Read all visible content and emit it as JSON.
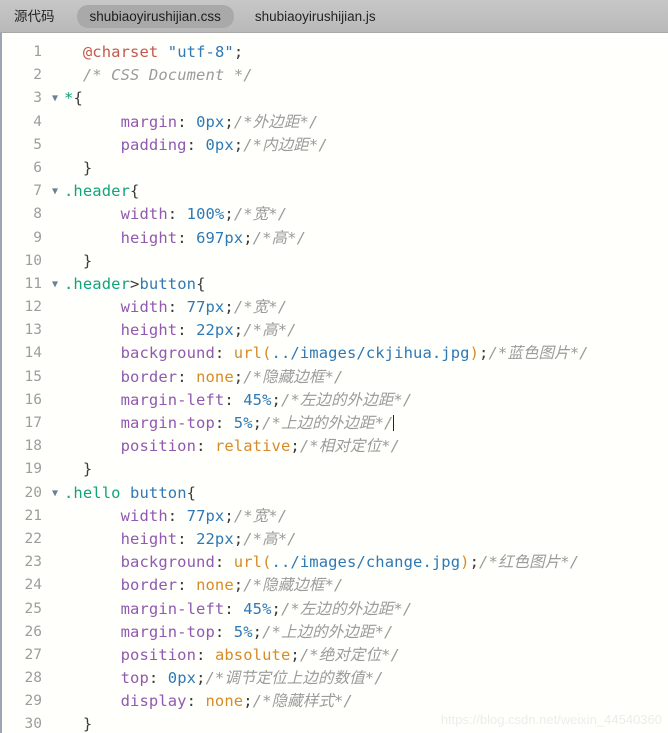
{
  "tabbar": {
    "source_label": "源代码",
    "tabs": [
      {
        "label": "shubiaoyirushijian.css",
        "active": true
      },
      {
        "label": "shubiaoyirushijian.js",
        "active": false
      }
    ]
  },
  "editor": {
    "language": "css",
    "caret_line": 17,
    "fold_marker_glyph": "▼",
    "colors": {
      "background": "#fffffb",
      "tabbar_background": "#c0c0c0",
      "active_tab_background": "#a9a9a9",
      "gutter_number": "#9d9d9d",
      "left_border": "#9aa6b4",
      "at_rule": "#c2594f",
      "string": "#2f79b5",
      "comment": "#9b9b9b",
      "selector_class": "#12a37c",
      "selector_tag": "#2f79b5",
      "property": "#9159b0",
      "value": "#2f79b5",
      "keyword": "#d78b29",
      "punctuation": "#3b3b3b"
    },
    "lines": [
      {
        "n": 1,
        "fold": false,
        "tokens": [
          {
            "t": "plain",
            "v": "  "
          },
          {
            "t": "at",
            "v": "@charset"
          },
          {
            "t": "plain",
            "v": " "
          },
          {
            "t": "str",
            "v": "\"utf-8\""
          },
          {
            "t": "punc",
            "v": ";"
          }
        ]
      },
      {
        "n": 2,
        "fold": false,
        "tokens": [
          {
            "t": "plain",
            "v": "  "
          },
          {
            "t": "com",
            "v": "/* CSS Document */"
          }
        ]
      },
      {
        "n": 3,
        "fold": true,
        "tokens": [
          {
            "t": "sel",
            "v": "*"
          },
          {
            "t": "punc",
            "v": "{"
          }
        ]
      },
      {
        "n": 4,
        "fold": false,
        "tokens": [
          {
            "t": "plain",
            "v": "      "
          },
          {
            "t": "prop",
            "v": "margin"
          },
          {
            "t": "punc",
            "v": ":"
          },
          {
            "t": "plain",
            "v": " "
          },
          {
            "t": "val",
            "v": "0px"
          },
          {
            "t": "punc",
            "v": ";"
          },
          {
            "t": "com",
            "v": "/*外边距*/"
          }
        ]
      },
      {
        "n": 5,
        "fold": false,
        "tokens": [
          {
            "t": "plain",
            "v": "      "
          },
          {
            "t": "prop",
            "v": "padding"
          },
          {
            "t": "punc",
            "v": ":"
          },
          {
            "t": "plain",
            "v": " "
          },
          {
            "t": "val",
            "v": "0px"
          },
          {
            "t": "punc",
            "v": ";"
          },
          {
            "t": "com",
            "v": "/*内边距*/"
          }
        ]
      },
      {
        "n": 6,
        "fold": false,
        "tokens": [
          {
            "t": "punc",
            "v": "  }"
          }
        ]
      },
      {
        "n": 7,
        "fold": true,
        "tokens": [
          {
            "t": "sel",
            "v": ".header"
          },
          {
            "t": "punc",
            "v": "{"
          }
        ]
      },
      {
        "n": 8,
        "fold": false,
        "tokens": [
          {
            "t": "plain",
            "v": "      "
          },
          {
            "t": "prop",
            "v": "width"
          },
          {
            "t": "punc",
            "v": ":"
          },
          {
            "t": "plain",
            "v": " "
          },
          {
            "t": "val",
            "v": "100%"
          },
          {
            "t": "punc",
            "v": ";"
          },
          {
            "t": "com",
            "v": "/*宽*/"
          }
        ]
      },
      {
        "n": 9,
        "fold": false,
        "tokens": [
          {
            "t": "plain",
            "v": "      "
          },
          {
            "t": "prop",
            "v": "height"
          },
          {
            "t": "punc",
            "v": ":"
          },
          {
            "t": "plain",
            "v": " "
          },
          {
            "t": "val",
            "v": "697px"
          },
          {
            "t": "punc",
            "v": ";"
          },
          {
            "t": "com",
            "v": "/*高*/"
          }
        ]
      },
      {
        "n": 10,
        "fold": false,
        "tokens": [
          {
            "t": "punc",
            "v": "  }"
          }
        ]
      },
      {
        "n": 11,
        "fold": true,
        "tokens": [
          {
            "t": "sel",
            "v": ".header"
          },
          {
            "t": "punc",
            "v": ">"
          },
          {
            "t": "tag",
            "v": "button"
          },
          {
            "t": "punc",
            "v": "{"
          }
        ]
      },
      {
        "n": 12,
        "fold": false,
        "tokens": [
          {
            "t": "plain",
            "v": "      "
          },
          {
            "t": "prop",
            "v": "width"
          },
          {
            "t": "punc",
            "v": ":"
          },
          {
            "t": "plain",
            "v": " "
          },
          {
            "t": "val",
            "v": "77px"
          },
          {
            "t": "punc",
            "v": ";"
          },
          {
            "t": "com",
            "v": "/*宽*/"
          }
        ]
      },
      {
        "n": 13,
        "fold": false,
        "tokens": [
          {
            "t": "plain",
            "v": "      "
          },
          {
            "t": "prop",
            "v": "height"
          },
          {
            "t": "punc",
            "v": ":"
          },
          {
            "t": "plain",
            "v": " "
          },
          {
            "t": "val",
            "v": "22px"
          },
          {
            "t": "punc",
            "v": ";"
          },
          {
            "t": "com",
            "v": "/*高*/"
          }
        ]
      },
      {
        "n": 14,
        "fold": false,
        "tokens": [
          {
            "t": "plain",
            "v": "      "
          },
          {
            "t": "prop",
            "v": "background"
          },
          {
            "t": "punc",
            "v": ":"
          },
          {
            "t": "plain",
            "v": " "
          },
          {
            "t": "func",
            "v": "url("
          },
          {
            "t": "val",
            "v": "../images/ckjihua.jpg"
          },
          {
            "t": "func",
            "v": ")"
          },
          {
            "t": "punc",
            "v": ";"
          },
          {
            "t": "com",
            "v": "/*蓝色图片*/"
          }
        ]
      },
      {
        "n": 15,
        "fold": false,
        "tokens": [
          {
            "t": "plain",
            "v": "      "
          },
          {
            "t": "prop",
            "v": "border"
          },
          {
            "t": "punc",
            "v": ":"
          },
          {
            "t": "plain",
            "v": " "
          },
          {
            "t": "kw",
            "v": "none"
          },
          {
            "t": "punc",
            "v": ";"
          },
          {
            "t": "com",
            "v": "/*隐藏边框*/"
          }
        ]
      },
      {
        "n": 16,
        "fold": false,
        "tokens": [
          {
            "t": "plain",
            "v": "      "
          },
          {
            "t": "prop",
            "v": "margin-left"
          },
          {
            "t": "punc",
            "v": ":"
          },
          {
            "t": "plain",
            "v": " "
          },
          {
            "t": "val",
            "v": "45%"
          },
          {
            "t": "punc",
            "v": ";"
          },
          {
            "t": "com",
            "v": "/*左边的外边距*/"
          }
        ]
      },
      {
        "n": 17,
        "fold": false,
        "caret": true,
        "tokens": [
          {
            "t": "plain",
            "v": "      "
          },
          {
            "t": "prop",
            "v": "margin-top"
          },
          {
            "t": "punc",
            "v": ":"
          },
          {
            "t": "plain",
            "v": " "
          },
          {
            "t": "val",
            "v": "5%"
          },
          {
            "t": "punc",
            "v": ";"
          },
          {
            "t": "com",
            "v": "/*上边的外边距*/"
          }
        ]
      },
      {
        "n": 18,
        "fold": false,
        "tokens": [
          {
            "t": "plain",
            "v": "      "
          },
          {
            "t": "prop",
            "v": "position"
          },
          {
            "t": "punc",
            "v": ":"
          },
          {
            "t": "plain",
            "v": " "
          },
          {
            "t": "kw",
            "v": "relative"
          },
          {
            "t": "punc",
            "v": ";"
          },
          {
            "t": "com",
            "v": "/*相对定位*/"
          }
        ]
      },
      {
        "n": 19,
        "fold": false,
        "tokens": [
          {
            "t": "punc",
            "v": "  }"
          }
        ]
      },
      {
        "n": 20,
        "fold": true,
        "tokens": [
          {
            "t": "sel",
            "v": ".hello"
          },
          {
            "t": "plain",
            "v": " "
          },
          {
            "t": "tag",
            "v": "button"
          },
          {
            "t": "punc",
            "v": "{"
          }
        ]
      },
      {
        "n": 21,
        "fold": false,
        "tokens": [
          {
            "t": "plain",
            "v": "      "
          },
          {
            "t": "prop",
            "v": "width"
          },
          {
            "t": "punc",
            "v": ":"
          },
          {
            "t": "plain",
            "v": " "
          },
          {
            "t": "val",
            "v": "77px"
          },
          {
            "t": "punc",
            "v": ";"
          },
          {
            "t": "com",
            "v": "/*宽*/"
          }
        ]
      },
      {
        "n": 22,
        "fold": false,
        "tokens": [
          {
            "t": "plain",
            "v": "      "
          },
          {
            "t": "prop",
            "v": "height"
          },
          {
            "t": "punc",
            "v": ":"
          },
          {
            "t": "plain",
            "v": " "
          },
          {
            "t": "val",
            "v": "22px"
          },
          {
            "t": "punc",
            "v": ";"
          },
          {
            "t": "com",
            "v": "/*高*/"
          }
        ]
      },
      {
        "n": 23,
        "fold": false,
        "tokens": [
          {
            "t": "plain",
            "v": "      "
          },
          {
            "t": "prop",
            "v": "background"
          },
          {
            "t": "punc",
            "v": ":"
          },
          {
            "t": "plain",
            "v": " "
          },
          {
            "t": "func",
            "v": "url("
          },
          {
            "t": "val",
            "v": "../images/change.jpg"
          },
          {
            "t": "func",
            "v": ")"
          },
          {
            "t": "punc",
            "v": ";"
          },
          {
            "t": "com",
            "v": "/*红色图片*/"
          }
        ]
      },
      {
        "n": 24,
        "fold": false,
        "tokens": [
          {
            "t": "plain",
            "v": "      "
          },
          {
            "t": "prop",
            "v": "border"
          },
          {
            "t": "punc",
            "v": ":"
          },
          {
            "t": "plain",
            "v": " "
          },
          {
            "t": "kw",
            "v": "none"
          },
          {
            "t": "punc",
            "v": ";"
          },
          {
            "t": "com",
            "v": "/*隐藏边框*/"
          }
        ]
      },
      {
        "n": 25,
        "fold": false,
        "tokens": [
          {
            "t": "plain",
            "v": "      "
          },
          {
            "t": "prop",
            "v": "margin-left"
          },
          {
            "t": "punc",
            "v": ":"
          },
          {
            "t": "plain",
            "v": " "
          },
          {
            "t": "val",
            "v": "45%"
          },
          {
            "t": "punc",
            "v": ";"
          },
          {
            "t": "com",
            "v": "/*左边的外边距*/"
          }
        ]
      },
      {
        "n": 26,
        "fold": false,
        "tokens": [
          {
            "t": "plain",
            "v": "      "
          },
          {
            "t": "prop",
            "v": "margin-top"
          },
          {
            "t": "punc",
            "v": ":"
          },
          {
            "t": "plain",
            "v": " "
          },
          {
            "t": "val",
            "v": "5%"
          },
          {
            "t": "punc",
            "v": ";"
          },
          {
            "t": "com",
            "v": "/*上边的外边距*/"
          }
        ]
      },
      {
        "n": 27,
        "fold": false,
        "tokens": [
          {
            "t": "plain",
            "v": "      "
          },
          {
            "t": "prop",
            "v": "position"
          },
          {
            "t": "punc",
            "v": ":"
          },
          {
            "t": "plain",
            "v": " "
          },
          {
            "t": "kw",
            "v": "absolute"
          },
          {
            "t": "punc",
            "v": ";"
          },
          {
            "t": "com",
            "v": "/*绝对定位*/"
          }
        ]
      },
      {
        "n": 28,
        "fold": false,
        "tokens": [
          {
            "t": "plain",
            "v": "      "
          },
          {
            "t": "prop",
            "v": "top"
          },
          {
            "t": "punc",
            "v": ":"
          },
          {
            "t": "plain",
            "v": " "
          },
          {
            "t": "val",
            "v": "0px"
          },
          {
            "t": "punc",
            "v": ";"
          },
          {
            "t": "com",
            "v": "/*调节定位上边的数值*/"
          }
        ]
      },
      {
        "n": 29,
        "fold": false,
        "tokens": [
          {
            "t": "plain",
            "v": "      "
          },
          {
            "t": "prop",
            "v": "display"
          },
          {
            "t": "punc",
            "v": ":"
          },
          {
            "t": "plain",
            "v": " "
          },
          {
            "t": "kw",
            "v": "none"
          },
          {
            "t": "punc",
            "v": ";"
          },
          {
            "t": "com",
            "v": "/*隐藏样式*/"
          }
        ]
      },
      {
        "n": 30,
        "fold": false,
        "tokens": [
          {
            "t": "punc",
            "v": "  }"
          }
        ]
      }
    ]
  },
  "watermark": {
    "text": "https://blog.csdn.net/weixin_44540360"
  }
}
